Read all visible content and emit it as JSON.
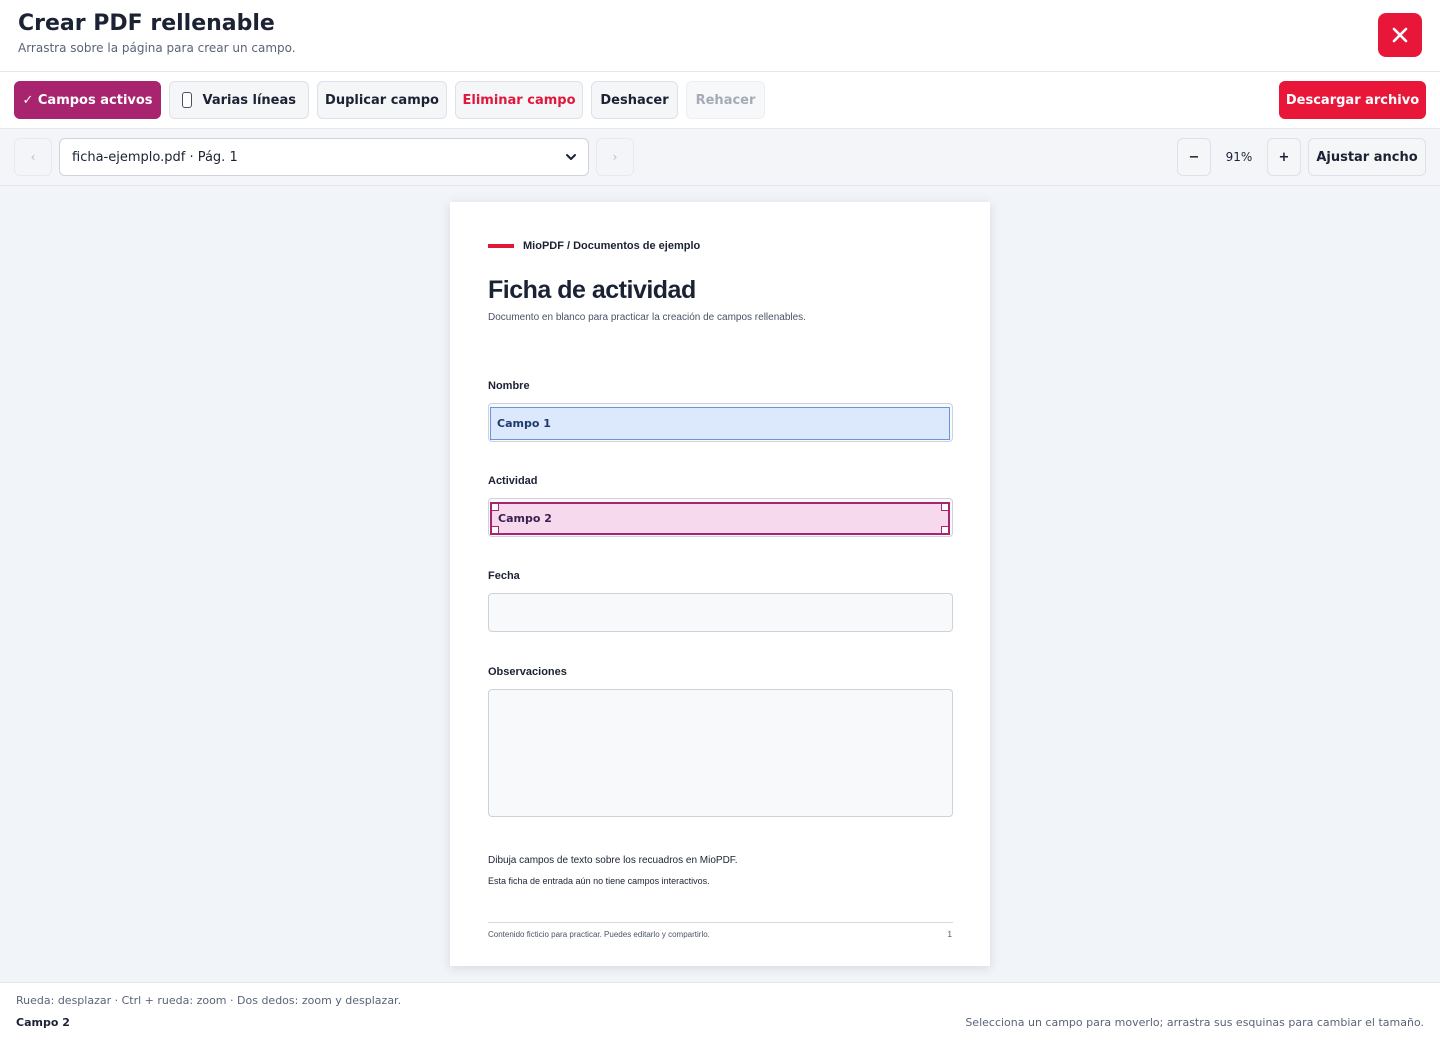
{
  "header": {
    "title": "Crear PDF rellenable",
    "subtitle": "Arrastra sobre la página para crear un campo."
  },
  "toolbar": {
    "campos_activos": "✓ Campos activos",
    "varias_lineas": "Varias líneas",
    "duplicar": "Duplicar campo",
    "eliminar": "Eliminar campo",
    "deshacer": "Deshacer",
    "rehacer": "Rehacer",
    "descargar": "Descargar archivo"
  },
  "nav": {
    "prev": "‹",
    "next": "›",
    "page_select": "ficha-ejemplo.pdf · Pág. 1",
    "zoom_out": "−",
    "zoom_value": "91%",
    "zoom_in": "+",
    "fit_width": "Ajustar ancho"
  },
  "document": {
    "brand": "MioPDF / Documentos de ejemplo",
    "title": "Ficha de actividad",
    "subtitle": "Documento en blanco para practicar la creación de campos rellenables.",
    "labels": [
      "Nombre",
      "Actividad",
      "Fecha",
      "Observaciones"
    ],
    "fields": [
      {
        "label": "Campo 1",
        "selected": false
      },
      {
        "label": "Campo 2",
        "selected": true
      }
    ],
    "notes": [
      "Dibuja campos de texto sobre los recuadros en MioPDF.",
      "Esta ficha de entrada aún no tiene campos interactivos."
    ],
    "footer": "Contenido ficticio para practicar. Puedes editarlo y compartirlo.",
    "page_number": "1"
  },
  "status": {
    "hint": "Rueda: desplazar · Ctrl + rueda: zoom · Dos dedos: zoom y desplazar.",
    "selected_field": "Campo 2",
    "help": "Selecciona un campo para moverlo; arrastra sus esquinas para cambiar el tamaño."
  },
  "colors": {
    "accent": "#a8246f",
    "danger": "#e8173a",
    "field_blue": "#dce8fb",
    "field_pink": "#f6d9ec"
  },
  "icons": {
    "close": "close-icon",
    "checkbox": "checkbox-icon",
    "select_chevron": "chevron-down-icon"
  }
}
